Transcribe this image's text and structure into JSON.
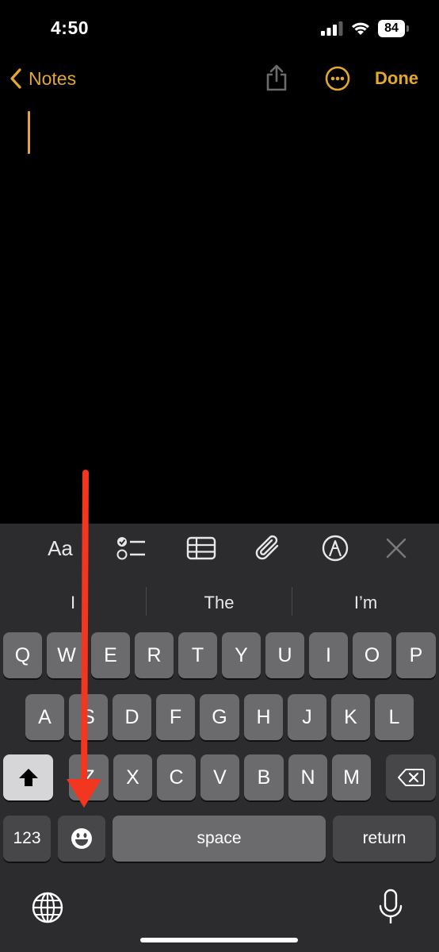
{
  "status": {
    "time": "4:50",
    "battery": "84"
  },
  "nav": {
    "back_label": "Notes",
    "done_label": "Done"
  },
  "toolbar": {
    "format_label": "Aa"
  },
  "suggestions": [
    "I",
    "The",
    "I’m"
  ],
  "keys": {
    "row1": [
      "Q",
      "W",
      "E",
      "R",
      "T",
      "Y",
      "U",
      "I",
      "O",
      "P"
    ],
    "row2": [
      "A",
      "S",
      "D",
      "F",
      "G",
      "H",
      "J",
      "K",
      "L"
    ],
    "row3": [
      "Z",
      "X",
      "C",
      "V",
      "B",
      "N",
      "M"
    ],
    "numbers_label": "123",
    "space_label": "space",
    "return_label": "return"
  },
  "colors": {
    "accent": "#e4a82b",
    "annotation_arrow": "#f2361f"
  },
  "icons": [
    "signal-icon",
    "wifi-icon",
    "share-icon",
    "more-icon",
    "checklist-icon",
    "table-icon",
    "attachment-icon",
    "markup-icon",
    "close-icon",
    "shift-icon",
    "delete-icon",
    "emoji-icon",
    "globe-icon",
    "microphone-icon"
  ]
}
